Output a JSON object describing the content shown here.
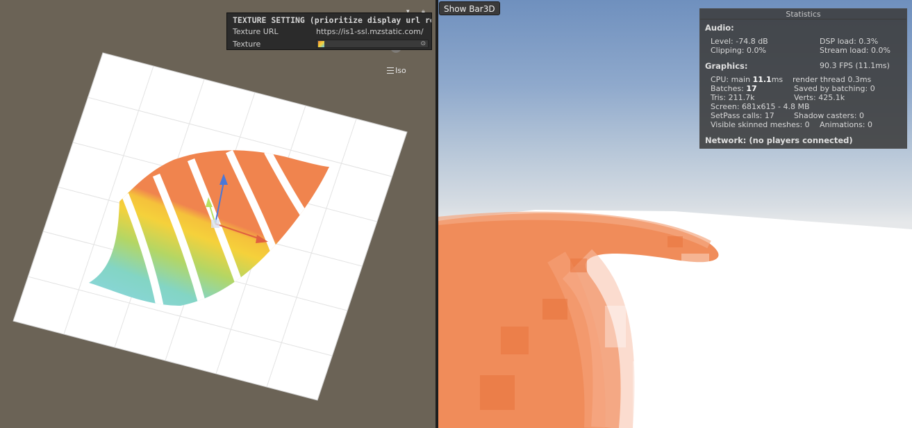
{
  "scene": {
    "texture_panel": {
      "title": "TEXTURE SETTING (prioritize display url res",
      "url_label": "Texture URL",
      "url_value": "https://is1-ssl.mzstatic.com/",
      "texture_label": "Texture"
    },
    "iso_label": "Iso"
  },
  "game": {
    "show_button": "Show Bar3D",
    "stats": {
      "title": "Statistics",
      "audio_label": "Audio:",
      "level": "Level: -74.8 dB",
      "dsp": "DSP load: 0.3%",
      "clipping": "Clipping: 0.0%",
      "stream": "Stream load: 0.0%",
      "graphics_label": "Graphics:",
      "fps": "90.3 FPS (11.1ms)",
      "cpu_prefix": "CPU: main ",
      "cpu_main": "11.1",
      "cpu_suffix": "ms",
      "render_thread": "render thread 0.3ms",
      "batches_prefix": "Batches: ",
      "batches": "17",
      "saved": "Saved by batching: 0",
      "tris": "Tris: 211.7k",
      "verts": "Verts: 425.1k",
      "screen": "Screen: 681x615 - 4.8 MB",
      "setpass": "SetPass calls: 17",
      "shadow": "Shadow casters: 0",
      "skinned": "Visible skinned meshes: 0",
      "animations": "Animations: 0",
      "network": "Network: (no players connected)"
    }
  },
  "colors": {
    "orange": "#f0844e",
    "yellow": "#f5d13b",
    "green": "#b4d664",
    "teal": "#83d5c4",
    "blue": "#8fd6ee",
    "scene_bg": "#6b6356"
  }
}
